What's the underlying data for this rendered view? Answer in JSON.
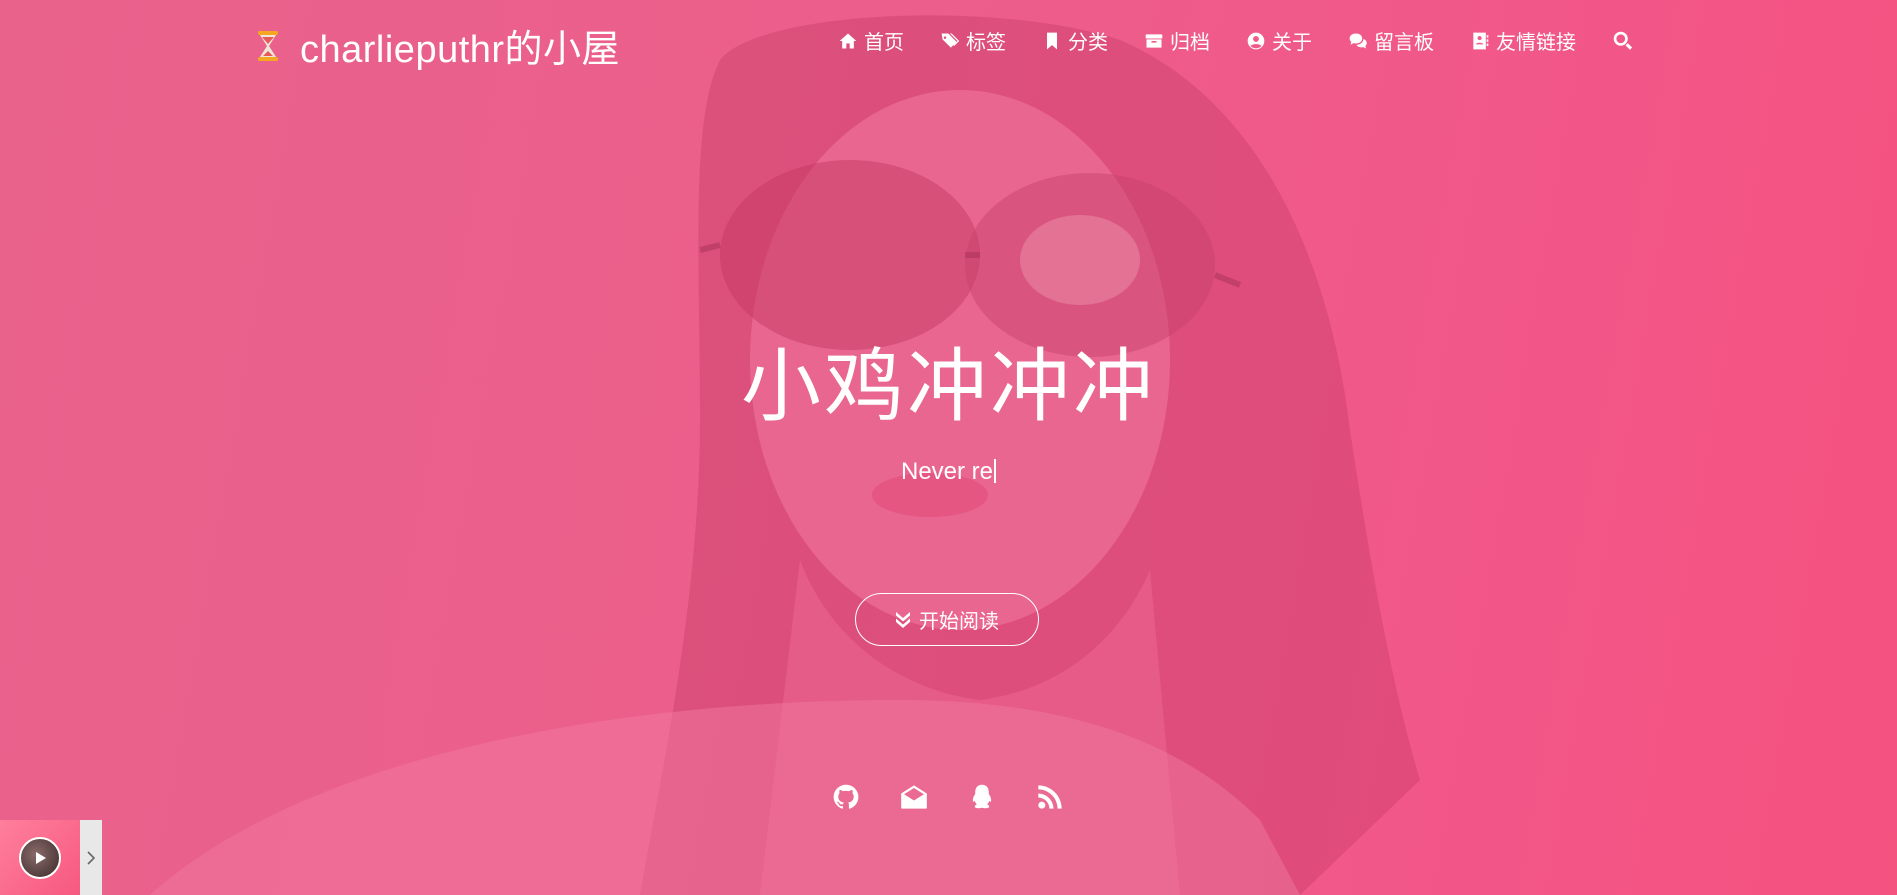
{
  "brand": {
    "title": "charlieputhr的小屋",
    "logo_icon": "hourglass-icon"
  },
  "nav": {
    "items": [
      {
        "label": "首页",
        "icon": "home-icon"
      },
      {
        "label": "标签",
        "icon": "tags-icon"
      },
      {
        "label": "分类",
        "icon": "bookmark-icon"
      },
      {
        "label": "归档",
        "icon": "archive-icon"
      },
      {
        "label": "关于",
        "icon": "user-circle-icon"
      },
      {
        "label": "留言板",
        "icon": "comments-icon"
      },
      {
        "label": "友情链接",
        "icon": "address-book-icon"
      }
    ],
    "search_icon": "search-icon"
  },
  "hero": {
    "heading": "小鸡冲冲冲",
    "subtitle": "Never re",
    "read_button": "开始阅读",
    "read_icon": "double-chevron-down-icon",
    "socials": [
      "github-icon",
      "email-icon",
      "qq-icon",
      "rss-icon"
    ]
  },
  "player": {
    "play_icon": "play-icon",
    "toggle_icon": "chevron-right-icon"
  },
  "colors": {
    "overlay_pink": "#ec5e8b",
    "text": "#ffffff"
  }
}
